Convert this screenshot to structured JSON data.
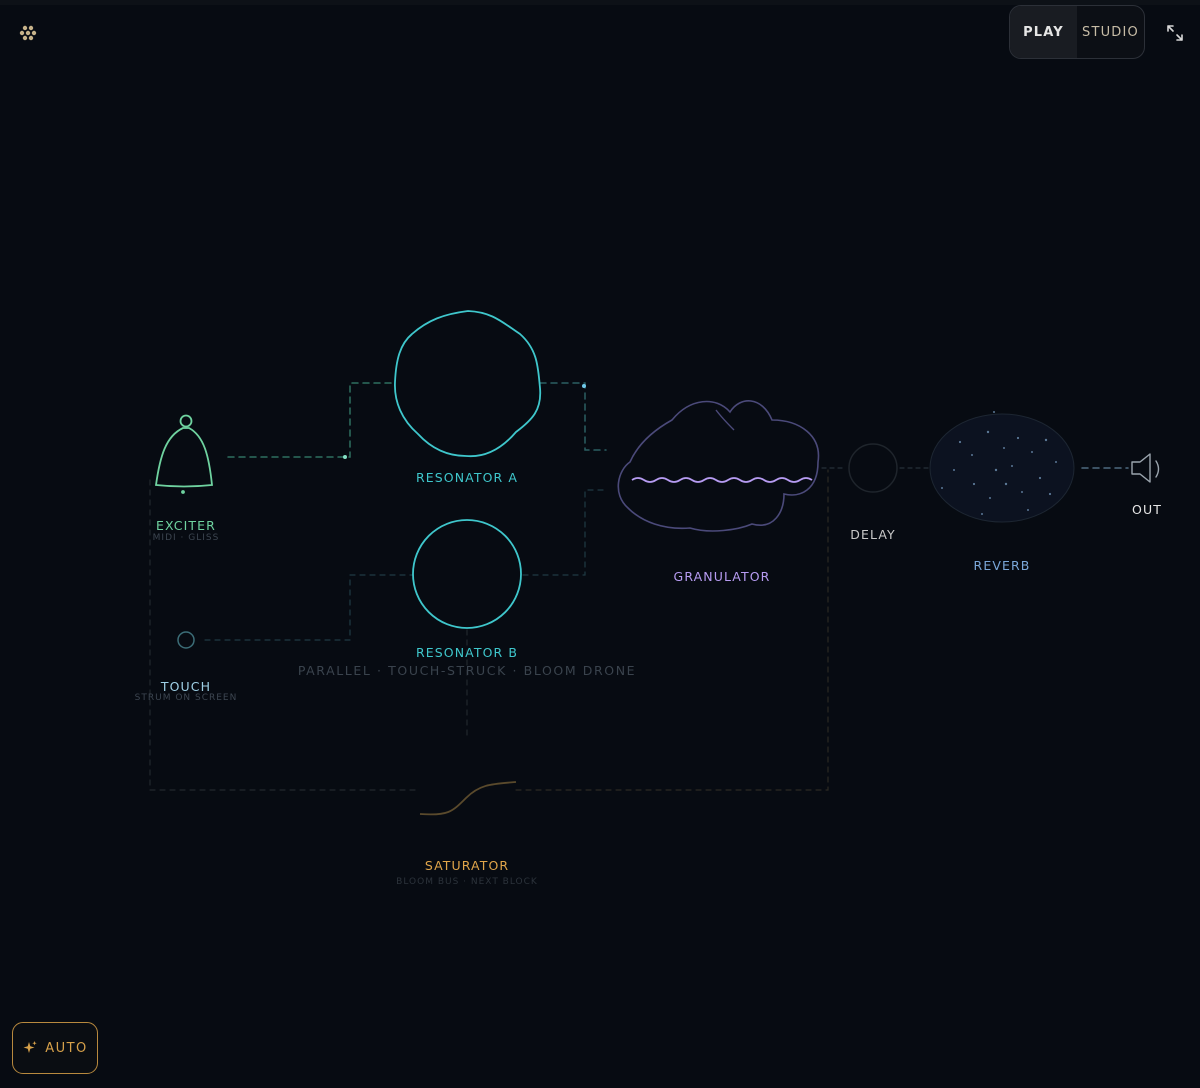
{
  "header": {
    "menu_icon": "dots-grid-icon",
    "mode_play": "PLAY",
    "mode_studio": "STUDIO",
    "active_mode": "PLAY",
    "expand_icon": "expand-arrows-icon"
  },
  "modules": {
    "exciter": {
      "label": "EXCITER",
      "sub": "MIDI · GLISS",
      "color": "#6fd3a0"
    },
    "touch": {
      "label": "TOUCH",
      "sub": "STRUM ON SCREEN",
      "color": "#9fd0e6"
    },
    "resonator_a": {
      "label": "RESONATOR A",
      "color": "#3fc7cc"
    },
    "resonator_b": {
      "label": "RESONATOR B",
      "color": "#3fc7cc"
    },
    "resonator_note": "PARALLEL · TOUCH-STRUCK · BLOOM DRONE",
    "granulator": {
      "label": "GRANULATOR",
      "color": "#b79cf2"
    },
    "delay": {
      "label": "DELAY",
      "color": "#c9c9c9"
    },
    "reverb": {
      "label": "REVERB",
      "color": "#7aa7d9"
    },
    "out": {
      "label": "OUT",
      "color": "#e6e6e6"
    },
    "saturator": {
      "label": "SATURATOR",
      "sub": "BLOOM BUS · NEXT BLOCK",
      "color": "#e0a54a"
    }
  },
  "auto_button": {
    "label": "AUTO",
    "icon": "sparkle-icon",
    "color": "#d6a04a"
  }
}
